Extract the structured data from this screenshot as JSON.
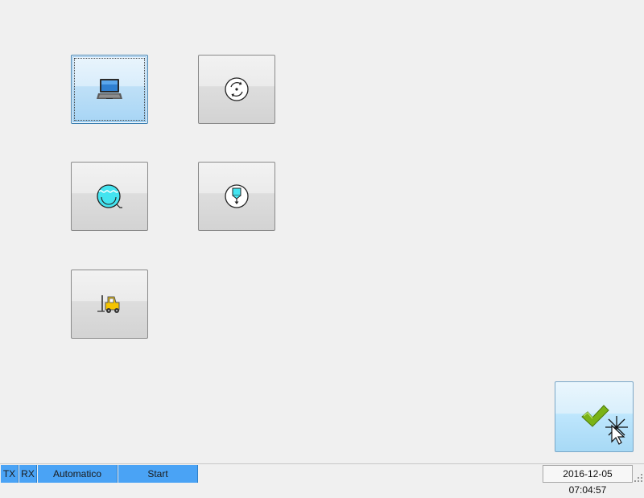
{
  "tiles": [
    {
      "name": "laptop",
      "icon": "laptop-icon",
      "selected": true
    },
    {
      "name": "rotate",
      "icon": "rotation-icon",
      "selected": false
    },
    {
      "name": "tank",
      "icon": "water-tank-icon",
      "selected": false
    },
    {
      "name": "dispense",
      "icon": "dispenser-icon",
      "selected": false
    },
    {
      "name": "forklift",
      "icon": "forklift-icon",
      "selected": false
    }
  ],
  "confirm": {
    "icon": "checkmark-icon"
  },
  "statusbar": {
    "tx": "TX",
    "rx": "RX",
    "mode": "Automatico",
    "state": "Start",
    "datetime": "2016-12-05 07:04:57"
  },
  "colors": {
    "accent_blue": "#4aa3f5",
    "tile_border": "#8a8a8a",
    "check_green": "#7ab317",
    "cyan": "#44e4f0",
    "forklift_yellow": "#f5c400"
  }
}
